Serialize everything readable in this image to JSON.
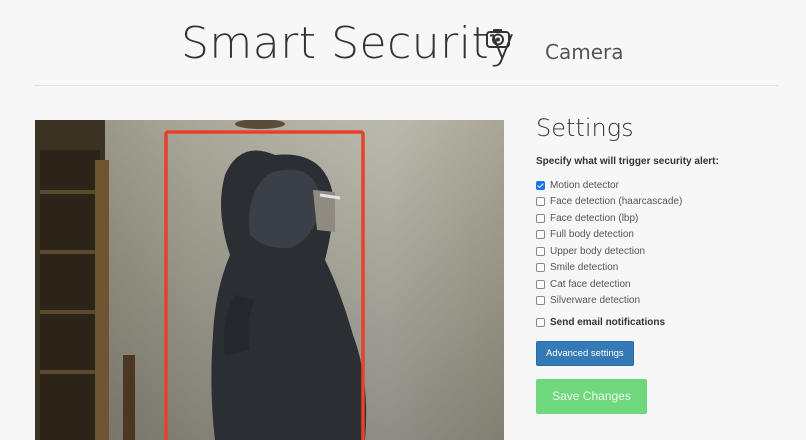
{
  "header": {
    "title": "Smart Security",
    "subtitle": "Camera",
    "icon": "camera-icon"
  },
  "feed": {
    "description_icon": "camera-feed",
    "detection_box_color": "#e8412b"
  },
  "settings": {
    "title": "Settings",
    "trigger_label": "Specify what will trigger security alert:",
    "detectors": [
      {
        "label": "Motion detector",
        "checked": true
      },
      {
        "label": "Face detection (haarcascade)",
        "checked": false
      },
      {
        "label": "Face detection (lbp)",
        "checked": false
      },
      {
        "label": "Full body detection",
        "checked": false
      },
      {
        "label": "Upper body detection",
        "checked": false
      },
      {
        "label": "Smile detection",
        "checked": false
      },
      {
        "label": "Cat face detection",
        "checked": false
      },
      {
        "label": "Silverware detection",
        "checked": false
      }
    ],
    "email_label": "Send email notifications",
    "email_checked": false,
    "advanced_button": "Advanced settings",
    "save_button": "Save Changes"
  },
  "colors": {
    "primary": "#337ab7",
    "success": "#6fd77c",
    "checkbox_checked": "#1a73e8"
  }
}
